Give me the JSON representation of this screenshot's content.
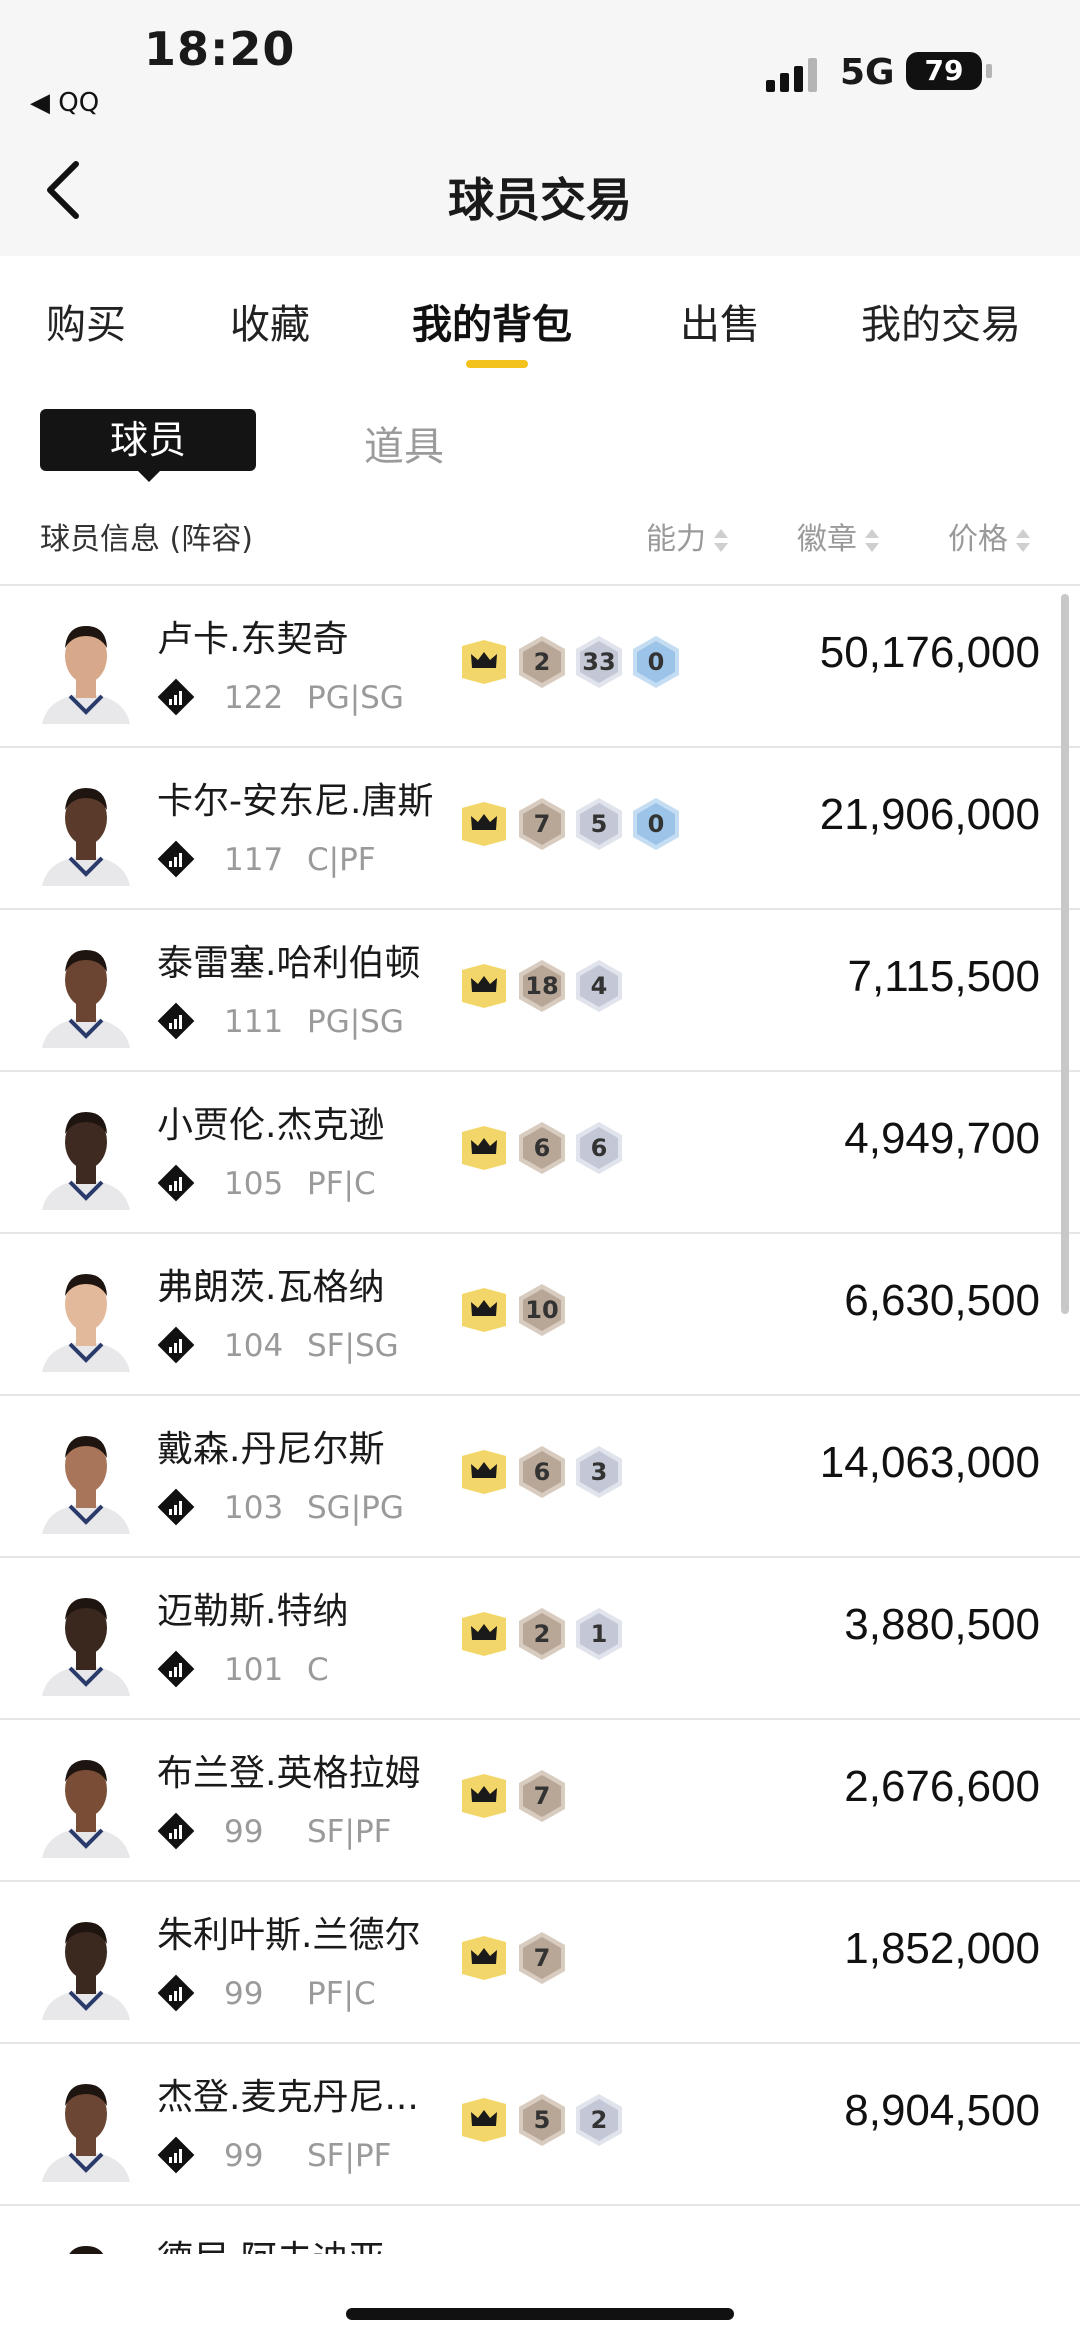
{
  "status_bar": {
    "time": "18:20",
    "back_app": "◀ QQ",
    "network": "5G",
    "battery": "79"
  },
  "nav": {
    "title": "球员交易"
  },
  "tabs": [
    {
      "label": "购买",
      "active": false
    },
    {
      "label": "收藏",
      "active": false
    },
    {
      "label": "我的背包",
      "active": true
    },
    {
      "label": "出售",
      "active": false
    },
    {
      "label": "我的交易",
      "active": false
    }
  ],
  "subtabs": {
    "active": "球员",
    "inactive": "道具"
  },
  "columns": {
    "info": "球员信息 (阵容)",
    "ability": "能力",
    "badges": "徽章",
    "price": "价格"
  },
  "colors": {
    "accent": "#f3c21c",
    "bronze": "#b7a594",
    "silver": "#c3c7d4",
    "gold_hex": "#9ec4e6"
  },
  "players": [
    {
      "name": "卢卡.东契奇",
      "rating": "122",
      "position": "PG|SG",
      "badges": [
        {
          "type": "bronze",
          "count": "2"
        },
        {
          "type": "silver",
          "count": "33"
        },
        {
          "type": "blue",
          "count": "0"
        }
      ],
      "price": "50,176,000"
    },
    {
      "name": "卡尔-安东尼.唐斯",
      "rating": "117",
      "position": "C|PF",
      "badges": [
        {
          "type": "bronze",
          "count": "7"
        },
        {
          "type": "silver",
          "count": "5"
        },
        {
          "type": "blue",
          "count": "0"
        }
      ],
      "price": "21,906,000"
    },
    {
      "name": "泰雷塞.哈利伯顿",
      "rating": "111",
      "position": "PG|SG",
      "badges": [
        {
          "type": "bronze",
          "count": "18"
        },
        {
          "type": "silver",
          "count": "4"
        }
      ],
      "price": "7,115,500"
    },
    {
      "name": "小贾伦.杰克逊",
      "rating": "105",
      "position": "PF|C",
      "badges": [
        {
          "type": "bronze",
          "count": "6"
        },
        {
          "type": "silver",
          "count": "6"
        }
      ],
      "price": "4,949,700"
    },
    {
      "name": "弗朗茨.瓦格纳",
      "rating": "104",
      "position": "SF|SG",
      "badges": [
        {
          "type": "bronze",
          "count": "10"
        }
      ],
      "price": "6,630,500"
    },
    {
      "name": "戴森.丹尼尔斯",
      "rating": "103",
      "position": "SG|PG",
      "badges": [
        {
          "type": "bronze",
          "count": "6"
        },
        {
          "type": "silver",
          "count": "3"
        }
      ],
      "price": "14,063,000"
    },
    {
      "name": "迈勒斯.特纳",
      "rating": "101",
      "position": "C",
      "badges": [
        {
          "type": "bronze",
          "count": "2"
        },
        {
          "type": "silver",
          "count": "1"
        }
      ],
      "price": "3,880,500"
    },
    {
      "name": "布兰登.英格拉姆",
      "rating": "99",
      "position": "SF|PF",
      "badges": [
        {
          "type": "bronze",
          "count": "7"
        }
      ],
      "price": "2,676,600"
    },
    {
      "name": "朱利叶斯.兰德尔",
      "rating": "99",
      "position": "PF|C",
      "badges": [
        {
          "type": "bronze",
          "count": "7"
        }
      ],
      "price": "1,852,000"
    },
    {
      "name": "杰登.麦克丹尼...",
      "rating": "99",
      "position": "SF|PF",
      "badges": [
        {
          "type": "bronze",
          "count": "5"
        },
        {
          "type": "silver",
          "count": "2"
        }
      ],
      "price": "8,904,500"
    },
    {
      "name": "德尼.阿夫迪亚",
      "rating": "",
      "position": "",
      "badges": [],
      "price": ""
    }
  ]
}
